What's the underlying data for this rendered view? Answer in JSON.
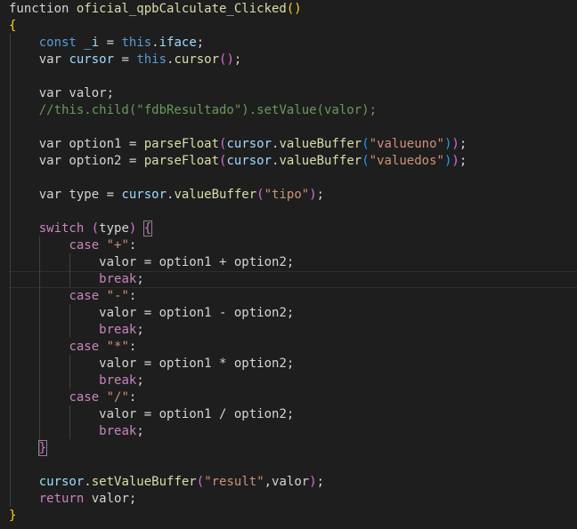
{
  "theme": {
    "background": "#1e1e1e",
    "default": "#d4d4d4",
    "keyword": "#569cd6",
    "control": "#c586c0",
    "function": "#dcdcaa",
    "variable": "#9cdcfe",
    "string": "#ce9178",
    "comment": "#6a9955",
    "bracket_gold": "#ffd700",
    "bracket_orchid": "#da70d6",
    "bracket_blue": "#179fff"
  },
  "lines": [
    {
      "indent": 0,
      "tokens": [
        [
          "default",
          "function "
        ],
        [
          "function",
          "oficial_qpbCalculate_Clicked"
        ],
        [
          "br1",
          "()"
        ]
      ]
    },
    {
      "indent": 0,
      "tokens": [
        [
          "br1",
          "{"
        ]
      ]
    },
    {
      "indent": 1,
      "tokens": [
        [
          "keyword",
          "const "
        ],
        [
          "variable",
          "_i"
        ],
        [
          "default",
          " = "
        ],
        [
          "keyword",
          "this"
        ],
        [
          "default",
          "."
        ],
        [
          "variable",
          "iface"
        ],
        [
          "default",
          ";"
        ]
      ]
    },
    {
      "indent": 1,
      "tokens": [
        [
          "default",
          "var "
        ],
        [
          "variable",
          "cursor"
        ],
        [
          "default",
          " = "
        ],
        [
          "keyword",
          "this"
        ],
        [
          "default",
          "."
        ],
        [
          "function",
          "cursor"
        ],
        [
          "br2",
          "()"
        ],
        [
          "default",
          ";"
        ]
      ]
    },
    {
      "indent": 0,
      "tokens": []
    },
    {
      "indent": 1,
      "tokens": [
        [
          "default",
          "var valor;"
        ]
      ]
    },
    {
      "indent": 1,
      "tokens": [
        [
          "comment",
          "//this.child(\"fdbResultado\").setValue(valor);"
        ]
      ]
    },
    {
      "indent": 0,
      "tokens": []
    },
    {
      "indent": 1,
      "tokens": [
        [
          "default",
          "var option1 = "
        ],
        [
          "function",
          "parseFloat"
        ],
        [
          "br2",
          "("
        ],
        [
          "variable",
          "cursor"
        ],
        [
          "default",
          "."
        ],
        [
          "function",
          "valueBuffer"
        ],
        [
          "br3",
          "("
        ],
        [
          "string",
          "\"valueuno\""
        ],
        [
          "br3",
          ")"
        ],
        [
          "br2",
          ")"
        ],
        [
          "default",
          ";"
        ]
      ]
    },
    {
      "indent": 1,
      "tokens": [
        [
          "default",
          "var option2 = "
        ],
        [
          "function",
          "parseFloat"
        ],
        [
          "br2",
          "("
        ],
        [
          "variable",
          "cursor"
        ],
        [
          "default",
          "."
        ],
        [
          "function",
          "valueBuffer"
        ],
        [
          "br3",
          "("
        ],
        [
          "string",
          "\"valuedos\""
        ],
        [
          "br3",
          ")"
        ],
        [
          "br2",
          ")"
        ],
        [
          "default",
          ";"
        ]
      ]
    },
    {
      "indent": 0,
      "tokens": []
    },
    {
      "indent": 1,
      "tokens": [
        [
          "default",
          "var type = "
        ],
        [
          "variable",
          "cursor"
        ],
        [
          "default",
          "."
        ],
        [
          "function",
          "valueBuffer"
        ],
        [
          "br2",
          "("
        ],
        [
          "string",
          "\"tipo\""
        ],
        [
          "br2",
          ")"
        ],
        [
          "default",
          ";"
        ]
      ]
    },
    {
      "indent": 0,
      "tokens": []
    },
    {
      "indent": 1,
      "tokens": [
        [
          "control",
          "switch "
        ],
        [
          "br2",
          "("
        ],
        [
          "default",
          "type"
        ],
        [
          "br2",
          ")"
        ],
        [
          "default",
          " "
        ],
        [
          "br2box",
          "{"
        ]
      ]
    },
    {
      "indent": 2,
      "tokens": [
        [
          "control",
          "case "
        ],
        [
          "string",
          "\"+\""
        ],
        [
          "default",
          ":"
        ]
      ]
    },
    {
      "indent": 3,
      "tokens": [
        [
          "default",
          "valor = option1 + option2;"
        ]
      ]
    },
    {
      "indent": 3,
      "tokens": [
        [
          "control",
          "break"
        ],
        [
          "default",
          ";"
        ]
      ]
    },
    {
      "indent": 2,
      "tokens": [
        [
          "control",
          "case "
        ],
        [
          "string",
          "\"-\""
        ],
        [
          "default",
          ":"
        ]
      ]
    },
    {
      "indent": 3,
      "tokens": [
        [
          "default",
          "valor = option1 - option2;"
        ]
      ]
    },
    {
      "indent": 3,
      "tokens": [
        [
          "control",
          "break"
        ],
        [
          "default",
          ";"
        ]
      ]
    },
    {
      "indent": 2,
      "tokens": [
        [
          "control",
          "case "
        ],
        [
          "string",
          "\"*\""
        ],
        [
          "default",
          ":"
        ]
      ]
    },
    {
      "indent": 3,
      "tokens": [
        [
          "default",
          "valor = option1 * option2;"
        ]
      ]
    },
    {
      "indent": 3,
      "tokens": [
        [
          "control",
          "break"
        ],
        [
          "default",
          ";"
        ]
      ]
    },
    {
      "indent": 2,
      "tokens": [
        [
          "control",
          "case "
        ],
        [
          "string",
          "\"/\""
        ],
        [
          "default",
          ":"
        ]
      ]
    },
    {
      "indent": 3,
      "tokens": [
        [
          "default",
          "valor = option1 / option2;"
        ]
      ]
    },
    {
      "indent": 3,
      "tokens": [
        [
          "control",
          "break"
        ],
        [
          "default",
          ";"
        ]
      ]
    },
    {
      "indent": 1,
      "tokens": [
        [
          "br2box",
          "}"
        ]
      ]
    },
    {
      "indent": 0,
      "tokens": []
    },
    {
      "indent": 1,
      "tokens": [
        [
          "variable",
          "cursor"
        ],
        [
          "default",
          "."
        ],
        [
          "function",
          "setValueBuffer"
        ],
        [
          "br2",
          "("
        ],
        [
          "string",
          "\"result\""
        ],
        [
          "default",
          ",valor"
        ],
        [
          "br2",
          ")"
        ],
        [
          "default",
          ";"
        ]
      ]
    },
    {
      "indent": 1,
      "tokens": [
        [
          "control",
          "return"
        ],
        [
          "default",
          " valor;"
        ]
      ]
    },
    {
      "indent": 0,
      "tokens": [
        [
          "br1",
          "}"
        ]
      ]
    }
  ]
}
